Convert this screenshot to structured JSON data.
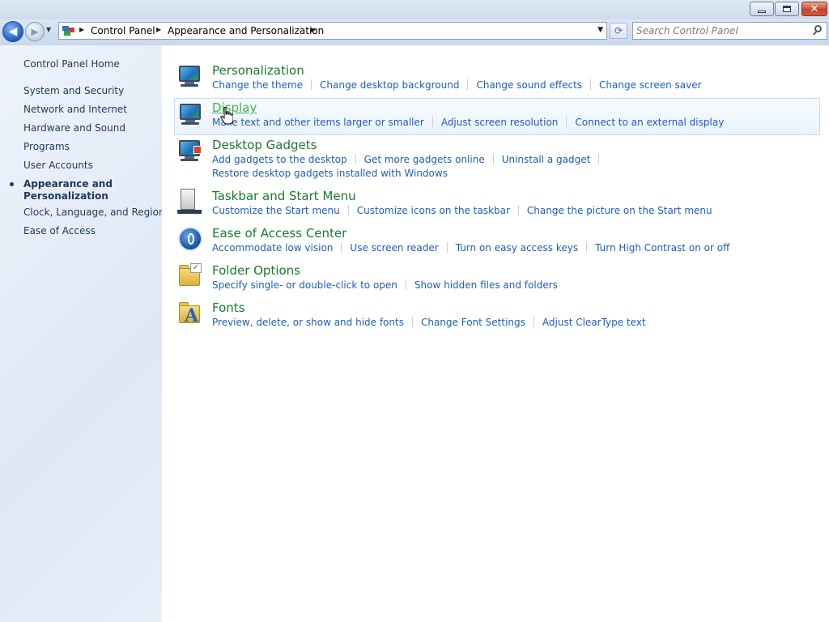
{
  "window": {
    "minimize_glyph": "",
    "close_glyph": "✕"
  },
  "nav": {
    "back_glyph": "◀",
    "forward_glyph": "▶",
    "breadcrumb": [
      "Control Panel",
      "Appearance and Personalization"
    ],
    "search_placeholder": "Search Control Panel"
  },
  "sidebar": {
    "items": [
      {
        "label": "Control Panel Home"
      },
      {
        "label": "System and Security"
      },
      {
        "label": "Network and Internet"
      },
      {
        "label": "Hardware and Sound"
      },
      {
        "label": "Programs"
      },
      {
        "label": "User Accounts"
      },
      {
        "label": "Appearance and Personalization",
        "line1": "Appearance and",
        "line2": "Personalization",
        "current": true
      },
      {
        "label": "Clock, Language, and Region"
      },
      {
        "label": "Ease of Access"
      }
    ]
  },
  "categories": [
    {
      "title": "Personalization",
      "icon": "personalization-icon",
      "links": [
        "Change the theme",
        "Change desktop background",
        "Change sound effects",
        "Change screen saver"
      ]
    },
    {
      "title": "Display",
      "icon": "display-icon",
      "hover": true,
      "links": [
        "Make text and other items larger or smaller",
        "Adjust screen resolution",
        "Connect to an external display"
      ]
    },
    {
      "title": "Desktop Gadgets",
      "icon": "gadgets-icon",
      "links": [
        "Add gadgets to the desktop",
        "Get more gadgets online",
        "Uninstall a gadget"
      ],
      "links2": [
        "Restore desktop gadgets installed with Windows"
      ]
    },
    {
      "title": "Taskbar and Start Menu",
      "icon": "taskbar-icon",
      "links": [
        "Customize the Start menu",
        "Customize icons on the taskbar",
        "Change the picture on the Start menu"
      ]
    },
    {
      "title": "Ease of Access Center",
      "icon": "ease-of-access-icon",
      "links": [
        "Accommodate low vision",
        "Use screen reader",
        "Turn on easy access keys",
        "Turn High Contrast on or off"
      ]
    },
    {
      "title": "Folder Options",
      "icon": "folder-options-icon",
      "links": [
        "Specify single- or double-click to open",
        "Show hidden files and folders"
      ]
    },
    {
      "title": "Fonts",
      "icon": "fonts-icon",
      "links": [
        "Preview, delete, or show and hide fonts",
        "Change Font Settings",
        "Adjust ClearType text"
      ]
    }
  ],
  "colors": {
    "category_title": "#1a7a33",
    "category_title_hover": "#3fb34a",
    "link": "#1e5ebe",
    "sidebar_text": "#1e395b"
  }
}
